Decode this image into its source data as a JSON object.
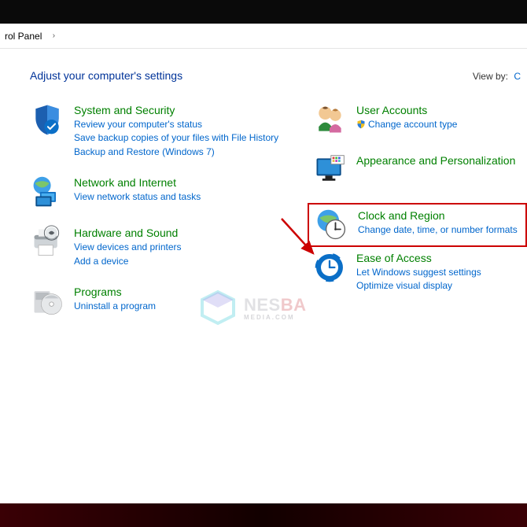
{
  "breadcrumb": {
    "segment": "rol Panel",
    "arrow": "›"
  },
  "header": {
    "heading": "Adjust your computer's settings",
    "viewby_label": "View by:",
    "viewby_value": "C"
  },
  "left": [
    {
      "id": "system-security",
      "icon": "shield",
      "title": "System and Security",
      "links": [
        "Review your computer's status",
        "Save backup copies of your files with File History",
        "Backup and Restore (Windows 7)"
      ]
    },
    {
      "id": "network",
      "icon": "globe-net",
      "title": "Network and Internet",
      "links": [
        "View network status and tasks"
      ]
    },
    {
      "id": "hardware",
      "icon": "printer",
      "title": "Hardware and Sound",
      "links": [
        "View devices and printers",
        "Add a device"
      ]
    },
    {
      "id": "programs",
      "icon": "disc",
      "title": "Programs",
      "links": [
        "Uninstall a program"
      ]
    }
  ],
  "right": [
    {
      "id": "users",
      "icon": "users",
      "title": "User Accounts",
      "shield_link": "Change account type"
    },
    {
      "id": "appearance",
      "icon": "monitor",
      "title": "Appearance and Personalization",
      "links": []
    },
    {
      "id": "clock-region",
      "icon": "clock-globe",
      "title": "Clock and Region",
      "links": [
        "Change date, time, or number formats"
      ],
      "highlighted": true
    },
    {
      "id": "ease",
      "icon": "ease",
      "title": "Ease of Access",
      "links": [
        "Let Windows suggest settings",
        "Optimize visual display"
      ]
    }
  ],
  "watermark": {
    "brand_a": "NES",
    "brand_b": "BA",
    "sub": "MEDIA.COM"
  }
}
